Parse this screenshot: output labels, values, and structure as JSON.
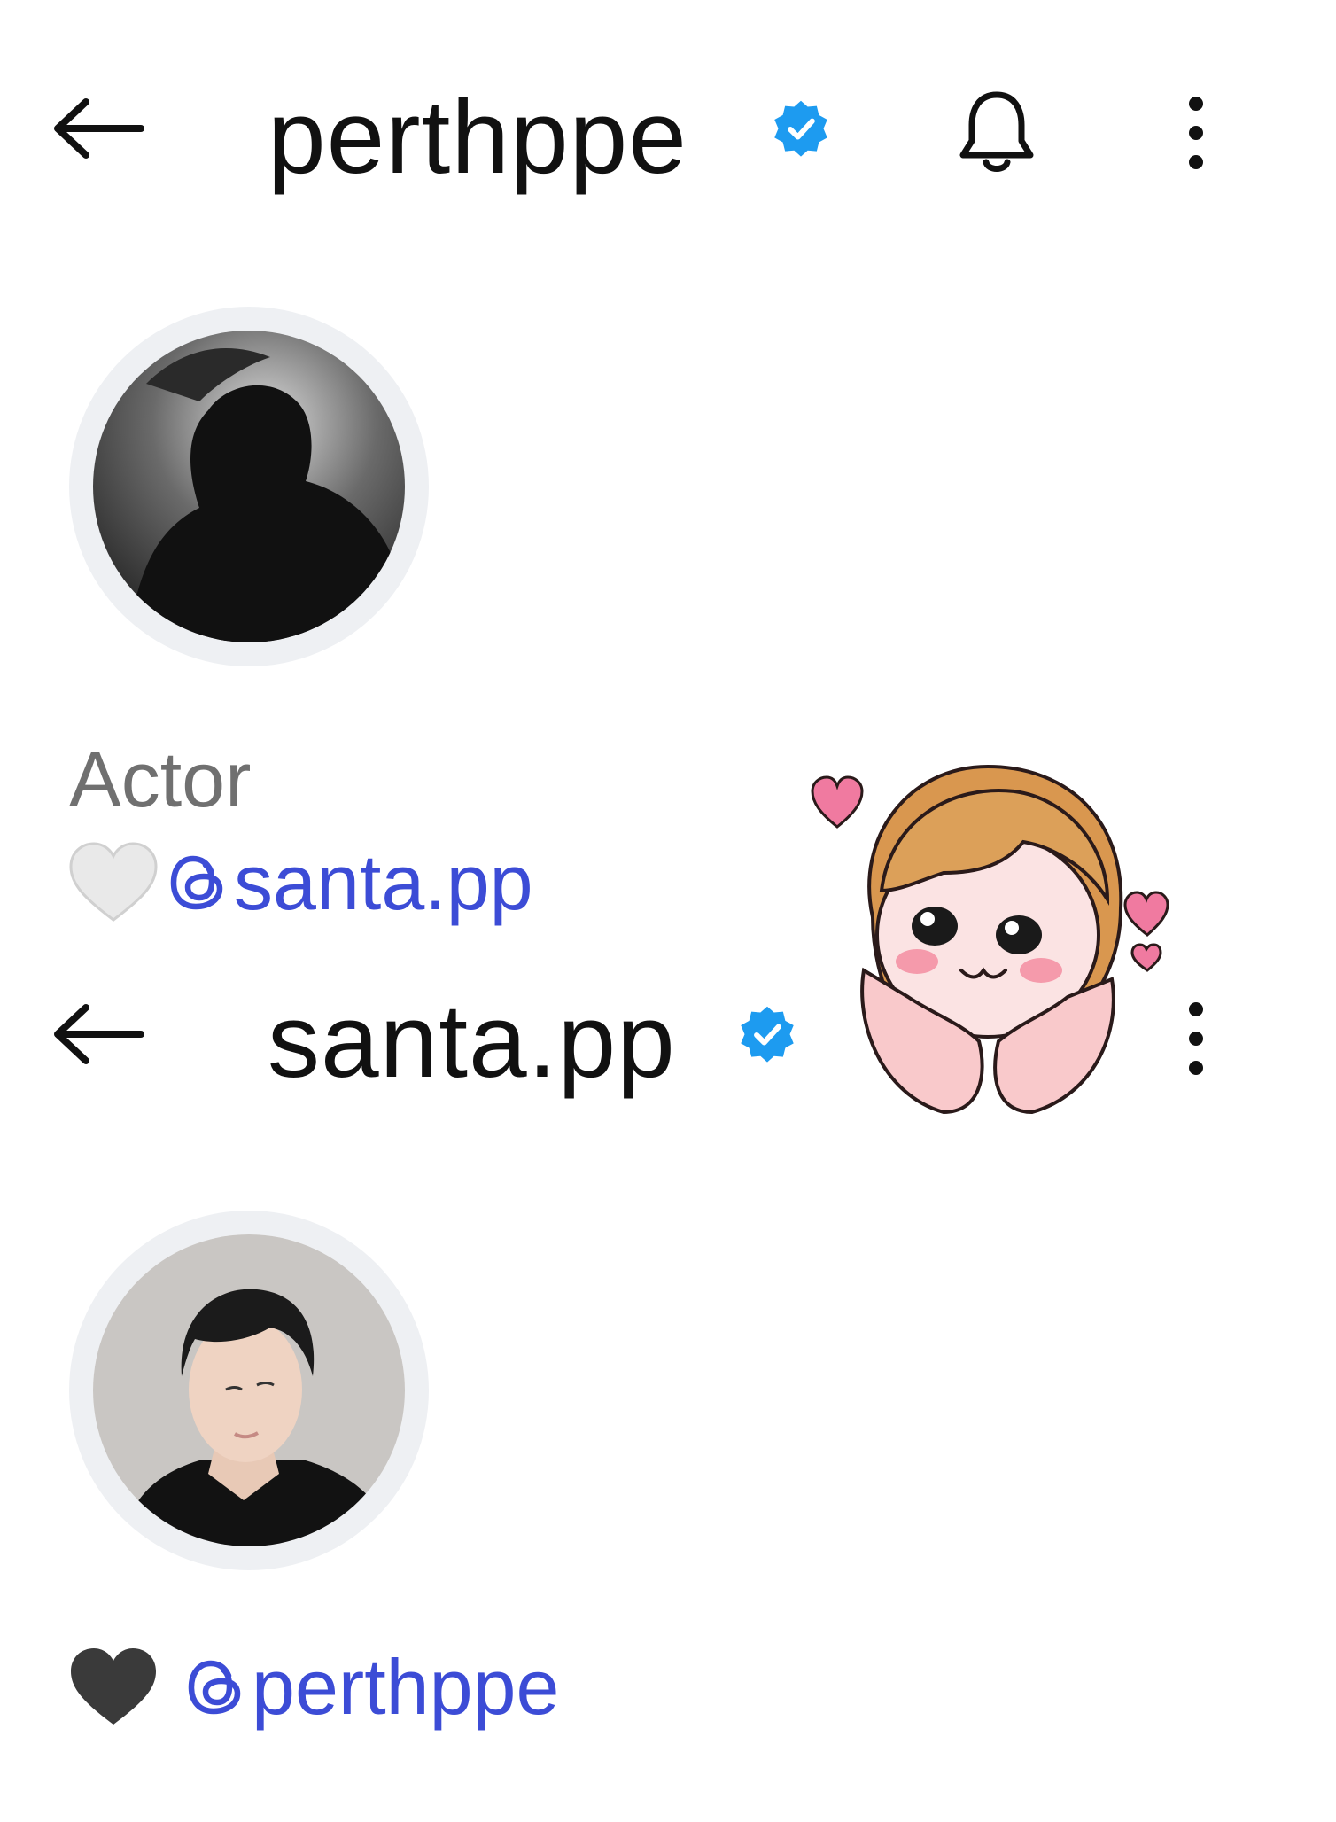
{
  "profiles": [
    {
      "username": "perthppe",
      "bio_category": "Actor",
      "linked_threads_handle": "santa.pp",
      "heart_color": "#e9e9e9"
    },
    {
      "username": "santa.pp",
      "linked_threads_handle": "perthppe",
      "heart_color": "#3a3a3a"
    }
  ],
  "colors": {
    "verified_badge": "#1d9bf0",
    "link": "#3c4cd6",
    "bio_text": "#707070",
    "avatar_ring": "#eef0f3"
  },
  "icons": {
    "back": "back-arrow-icon",
    "verified": "verified-badge-icon",
    "notifications": "bell-icon",
    "more": "more-vertical-icon",
    "threads": "threads-icon",
    "sticker": "blushing-girl-sticker"
  }
}
